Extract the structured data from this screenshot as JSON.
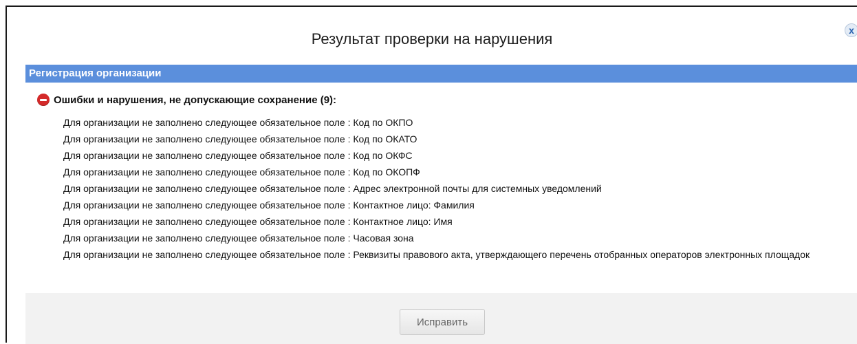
{
  "dialog": {
    "title": "Результат проверки на нарушения",
    "close_label": "x"
  },
  "section": {
    "header": "Регистрация организации"
  },
  "errors": {
    "heading": "Ошибки и нарушения, не допускающие сохранение (9):",
    "icon": "stop-icon",
    "icon_color": "#d42a2a",
    "items": [
      "Для организации не заполнено следующее обязательное поле : Код по ОКПО",
      "Для организации не заполнено следующее обязательное поле : Код по ОКАТО",
      "Для организации не заполнено следующее обязательное поле : Код по ОКФС",
      "Для организации не заполнено следующее обязательное поле : Код по ОКОПФ",
      "Для организации не заполнено следующее обязательное поле : Адрес электронной почты для системных уведомлений",
      "Для организации не заполнено следующее обязательное поле : Контактное лицо: Фамилия",
      "Для организации не заполнено следующее обязательное поле : Контактное лицо: Имя",
      "Для организации не заполнено следующее обязательное поле : Часовая зона",
      "Для организации не заполнено следующее обязательное поле : Реквизиты правового акта, утверждающего перечень отобранных операторов электронных площадок"
    ]
  },
  "footer": {
    "fix_button_label": "Исправить"
  },
  "colors": {
    "header_bg": "#5b8fdc",
    "footer_bg": "#f2f2f2"
  }
}
